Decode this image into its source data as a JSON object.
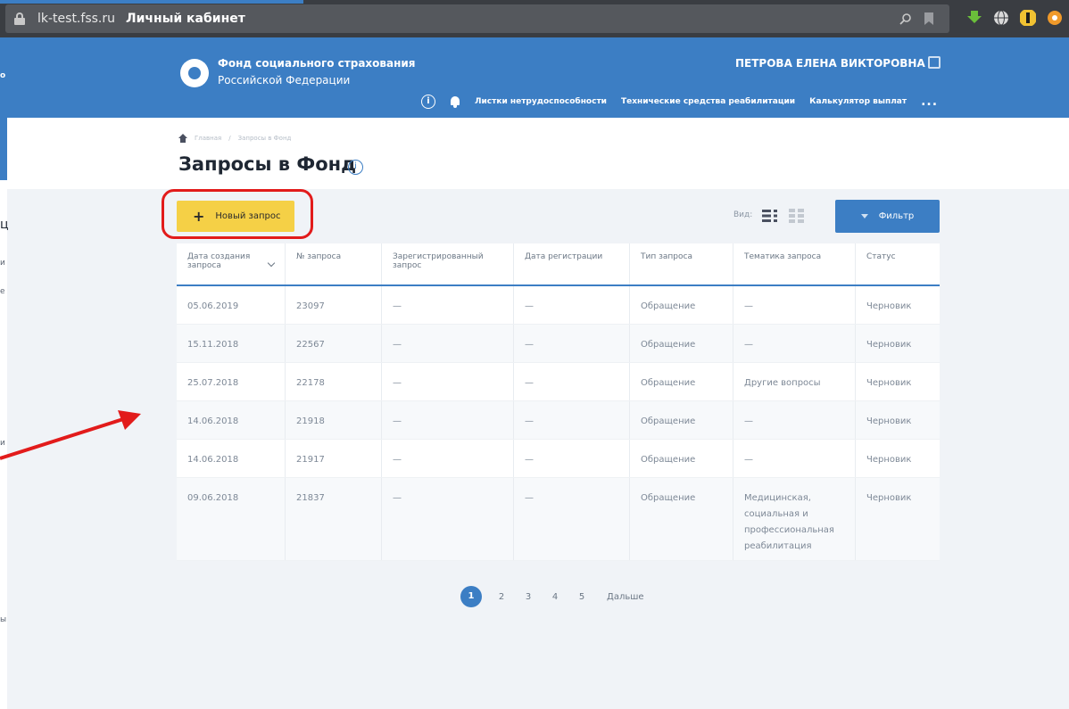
{
  "browser": {
    "url_domain": "lk-test.fss.ru",
    "tab_title": "Личный кабинет"
  },
  "header": {
    "org_line1": "Фонд социального страхования",
    "org_line2": "Российской Федерации",
    "user_name": "ПЕТРОВА ЕЛЕНА ВИКТОРОВНА",
    "info_glyph": "i",
    "nav_items": [
      "Листки нетрудоспособности",
      "Технические средства реабилитации",
      "Калькулятор выплат"
    ],
    "more_label": "..."
  },
  "breadcrumb": {
    "home": "Главная",
    "separator": "/",
    "current": "Запросы в Фонд"
  },
  "page": {
    "title": "Запросы в Фонд",
    "title_info_glyph": "i"
  },
  "toolbar": {
    "new_request_label": "Новый запрос",
    "plus_glyph": "+",
    "view_label": "Вид:",
    "filter_label": "Фильтр"
  },
  "table": {
    "columns": [
      "Дата создания запроса",
      "№ запроса",
      "Зарегистрированный запрос",
      "Дата регистрации",
      "Тип запроса",
      "Тематика запроса",
      "Статус"
    ],
    "rows": [
      [
        "05.06.2019",
        "23097",
        "—",
        "—",
        "Обращение",
        "—",
        "Черновик"
      ],
      [
        "15.11.2018",
        "22567",
        "—",
        "—",
        "Обращение",
        "—",
        "Черновик"
      ],
      [
        "25.07.2018",
        "22178",
        "—",
        "—",
        "Обращение",
        "Другие вопросы",
        "Черновик"
      ],
      [
        "14.06.2018",
        "21918",
        "—",
        "—",
        "Обращение",
        "—",
        "Черновик"
      ],
      [
        "14.06.2018",
        "21917",
        "—",
        "—",
        "Обращение",
        "—",
        "Черновик"
      ],
      [
        "09.06.2018",
        "21837",
        "—",
        "—",
        "Обращение",
        "Медицинская, социальная и профессиональная реабилитация",
        "Черновик"
      ]
    ]
  },
  "pagination": {
    "pages": [
      "1",
      "2",
      "3",
      "4",
      "5"
    ],
    "current": "1",
    "next_label": "Дальше"
  },
  "left_edge": {
    "fragments": [
      "о",
      "ц",
      "и",
      "е",
      "и",
      "ы"
    ]
  },
  "colors": {
    "brand_blue": "#3c7ec4",
    "accent_yellow": "#f5d046",
    "highlight_red": "#e21b1b"
  },
  "icons": [
    "lock-icon",
    "logo-icon",
    "logout-icon",
    "info-icon",
    "bell-icon",
    "home-icon",
    "plus-icon",
    "list-view-icon",
    "grid-view-icon",
    "filter-icon",
    "sort-chevron-icon",
    "arrow-annotation"
  ]
}
